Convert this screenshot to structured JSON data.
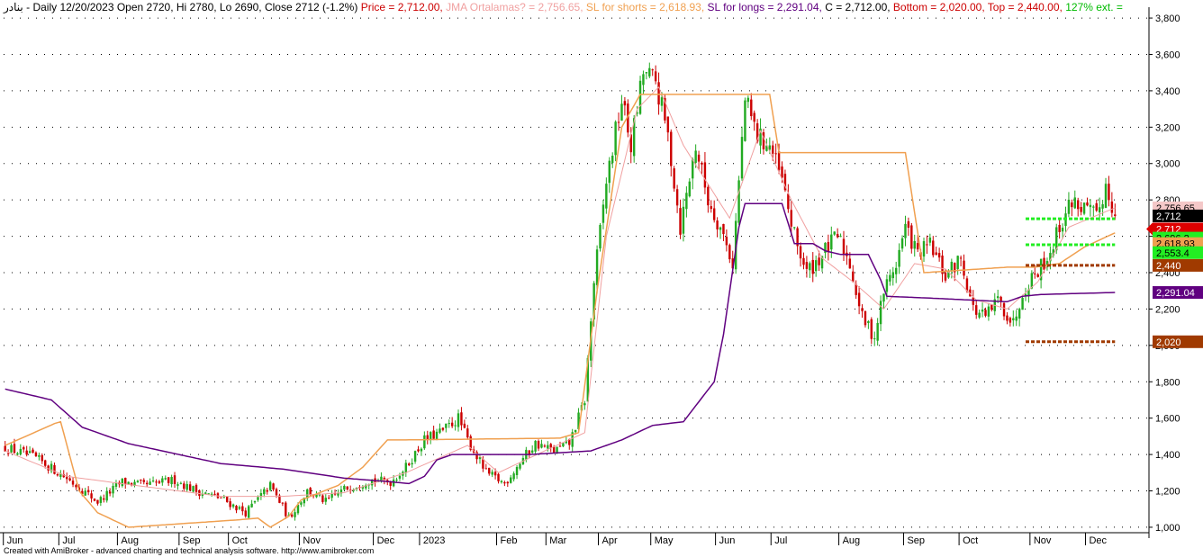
{
  "header": {
    "symbol": "بنادر",
    "info": "- Daily 12/20/2023 Open 2720, Hi 2780, Lo 2690, Close 2712 (-1.2%)",
    "price_label": "Price = 2,712.00,",
    "jma_label": "JMA Ortalamas? = 2,756.65,",
    "sls_label": "SL for shorts = 2,618.93,",
    "sll_label": "SL for longs = 2,291.04,",
    "c_label": "C = 2,712.00,",
    "bottom_label": "Bottom = 2,020.00,",
    "top_label": "Top = 2,440.00,",
    "ext_label": "127% ext. ="
  },
  "colors": {
    "up": "#22aa22",
    "down": "#cc0000",
    "price_label": "#cc0000",
    "jma": "#f0a0a0",
    "sl_shorts": "#f0a050",
    "sl_longs": "#600080",
    "bottom": "#cc0000",
    "top": "#cc0000",
    "ext": "#00bb00",
    "green_level": "#22ee22",
    "brown_level": "#a03a00"
  },
  "footer": "Created with AmiBroker - advanced charting and technical analysis software. http://www.amibroker.com",
  "chart_data": {
    "type": "candlestick",
    "ylim": [
      970,
      3830
    ],
    "yticks": [
      1000,
      1200,
      1400,
      1600,
      1800,
      2000,
      2200,
      2400,
      2600,
      2800,
      3000,
      3200,
      3400,
      3600,
      3800
    ],
    "ytick_labels": [
      "1,000",
      "1,200",
      "1,400",
      "1,600",
      "1,800",
      "2,000",
      "2,200",
      "2,400",
      "2,600",
      "2,800",
      "3,000",
      "3,200",
      "3,400",
      "3,600",
      "3,800"
    ],
    "xticks": [
      {
        "label": "Jun",
        "bar": 0
      },
      {
        "label": "Jul",
        "bar": 18
      },
      {
        "label": "Aug",
        "bar": 37
      },
      {
        "label": "Sep",
        "bar": 57
      },
      {
        "label": "Oct",
        "bar": 73
      },
      {
        "label": "Nov",
        "bar": 96
      },
      {
        "label": "Dec",
        "bar": 120
      },
      {
        "label": "2023",
        "bar": 135
      },
      {
        "label": "Feb",
        "bar": 160
      },
      {
        "label": "Mar",
        "bar": 176
      },
      {
        "label": "Apr",
        "bar": 193
      },
      {
        "label": "May",
        "bar": 210
      },
      {
        "label": "Jun",
        "bar": 231
      },
      {
        "label": "Jul",
        "bar": 249
      },
      {
        "label": "Aug",
        "bar": 271
      },
      {
        "label": "Sep",
        "bar": 292
      },
      {
        "label": "Oct",
        "bar": 310
      },
      {
        "label": "Nov",
        "bar": 333
      },
      {
        "label": "Dec",
        "bar": 351
      }
    ],
    "close_keyframes": [
      [
        0,
        1440
      ],
      [
        10,
        1380
      ],
      [
        20,
        1270
      ],
      [
        30,
        1140
      ],
      [
        38,
        1250
      ],
      [
        45,
        1230
      ],
      [
        55,
        1260
      ],
      [
        62,
        1200
      ],
      [
        70,
        1160
      ],
      [
        78,
        1080
      ],
      [
        86,
        1230
      ],
      [
        92,
        1050
      ],
      [
        98,
        1200
      ],
      [
        104,
        1140
      ],
      [
        110,
        1210
      ],
      [
        118,
        1260
      ],
      [
        125,
        1250
      ],
      [
        130,
        1330
      ],
      [
        136,
        1480
      ],
      [
        142,
        1530
      ],
      [
        147,
        1600
      ],
      [
        150,
        1480
      ],
      [
        156,
        1300
      ],
      [
        162,
        1240
      ],
      [
        168,
        1380
      ],
      [
        172,
        1460
      ],
      [
        178,
        1420
      ],
      [
        183,
        1460
      ],
      [
        188,
        1700
      ],
      [
        191,
        2350
      ],
      [
        195,
        2900
      ],
      [
        200,
        3350
      ],
      [
        203,
        3100
      ],
      [
        207,
        3500
      ],
      [
        211,
        3450
      ],
      [
        215,
        3150
      ],
      [
        219,
        2650
      ],
      [
        224,
        3100
      ],
      [
        228,
        2800
      ],
      [
        232,
        2650
      ],
      [
        236,
        2450
      ],
      [
        240,
        3350
      ],
      [
        244,
        3150
      ],
      [
        248,
        3100
      ],
      [
        252,
        2900
      ],
      [
        256,
        2600
      ],
      [
        260,
        2400
      ],
      [
        265,
        2500
      ],
      [
        270,
        2600
      ],
      [
        274,
        2450
      ],
      [
        278,
        2150
      ],
      [
        282,
        2050
      ],
      [
        285,
        2300
      ],
      [
        289,
        2450
      ],
      [
        292,
        2650
      ],
      [
        296,
        2500
      ],
      [
        300,
        2550
      ],
      [
        305,
        2380
      ],
      [
        310,
        2480
      ],
      [
        314,
        2200
      ],
      [
        318,
        2150
      ],
      [
        322,
        2250
      ],
      [
        327,
        2120
      ],
      [
        330,
        2300
      ],
      [
        334,
        2400
      ],
      [
        338,
        2480
      ],
      [
        342,
        2650
      ],
      [
        346,
        2800
      ],
      [
        350,
        2750
      ],
      [
        354,
        2700
      ],
      [
        357,
        2880
      ],
      [
        360,
        2712
      ]
    ],
    "last": {
      "open": 2720,
      "high": 2780,
      "low": 2690,
      "close": 2712
    },
    "jma_keyframes": [
      [
        0,
        1420
      ],
      [
        20,
        1280
      ],
      [
        40,
        1235
      ],
      [
        70,
        1170
      ],
      [
        90,
        1170
      ],
      [
        110,
        1190
      ],
      [
        130,
        1300
      ],
      [
        150,
        1450
      ],
      [
        160,
        1300
      ],
      [
        175,
        1420
      ],
      [
        188,
        1520
      ],
      [
        195,
        2600
      ],
      [
        205,
        3300
      ],
      [
        212,
        3420
      ],
      [
        220,
        3100
      ],
      [
        235,
        2700
      ],
      [
        245,
        3180
      ],
      [
        255,
        2800
      ],
      [
        265,
        2480
      ],
      [
        275,
        2350
      ],
      [
        285,
        2200
      ],
      [
        295,
        2450
      ],
      [
        305,
        2420
      ],
      [
        315,
        2250
      ],
      [
        325,
        2200
      ],
      [
        335,
        2350
      ],
      [
        345,
        2650
      ],
      [
        360,
        2756.65
      ]
    ],
    "sl_shorts_keyframes": [
      [
        0,
        1450
      ],
      [
        16,
        1570
      ],
      [
        18,
        1580
      ],
      [
        24,
        1200
      ],
      [
        30,
        1080
      ],
      [
        40,
        1000
      ],
      [
        75,
        1040
      ],
      [
        82,
        1050
      ],
      [
        86,
        1000
      ],
      [
        92,
        1060
      ],
      [
        96,
        1150
      ],
      [
        108,
        1230
      ],
      [
        116,
        1330
      ],
      [
        124,
        1480
      ],
      [
        128,
        1480
      ],
      [
        180,
        1490
      ],
      [
        186,
        1520
      ],
      [
        192,
        2300
      ],
      [
        200,
        3200
      ],
      [
        206,
        3380
      ],
      [
        248,
        3380
      ],
      [
        251,
        3060
      ],
      [
        292,
        3060
      ],
      [
        298,
        2400
      ],
      [
        325,
        2430
      ],
      [
        334,
        2430
      ],
      [
        342,
        2450
      ],
      [
        350,
        2540
      ],
      [
        360,
        2618.93
      ]
    ],
    "sl_longs_keyframes": [
      [
        0,
        1760
      ],
      [
        15,
        1700
      ],
      [
        25,
        1550
      ],
      [
        40,
        1460
      ],
      [
        70,
        1350
      ],
      [
        90,
        1320
      ],
      [
        110,
        1270
      ],
      [
        125,
        1250
      ],
      [
        131,
        1240
      ],
      [
        136,
        1280
      ],
      [
        140,
        1370
      ],
      [
        145,
        1400
      ],
      [
        170,
        1400
      ],
      [
        190,
        1420
      ],
      [
        200,
        1480
      ],
      [
        210,
        1560
      ],
      [
        220,
        1580
      ],
      [
        230,
        1800
      ],
      [
        233,
        2060
      ],
      [
        238,
        2650
      ],
      [
        240,
        2780
      ],
      [
        252,
        2780
      ],
      [
        256,
        2560
      ],
      [
        262,
        2560
      ],
      [
        266,
        2520
      ],
      [
        271,
        2500
      ],
      [
        280,
        2500
      ],
      [
        284,
        2360
      ],
      [
        286,
        2270
      ],
      [
        300,
        2260
      ],
      [
        325,
        2240
      ],
      [
        330,
        2270
      ],
      [
        336,
        2280
      ],
      [
        360,
        2291.04
      ]
    ],
    "levels": [
      {
        "name": "top",
        "value": 2440,
        "from_bar": 331,
        "to_bar": 360,
        "style": "brown"
      },
      {
        "name": "bottom",
        "value": 2020,
        "from_bar": 331,
        "to_bar": 360,
        "style": "brown"
      },
      {
        "name": "level_a",
        "value": 2696.2,
        "from_bar": 331,
        "to_bar": 360,
        "style": "green"
      },
      {
        "name": "level_b",
        "value": 2553.4,
        "from_bar": 331,
        "to_bar": 360,
        "style": "green"
      }
    ],
    "right_labels": [
      {
        "text": "2,756.65",
        "value": 2756.65,
        "bg": "#f4c8c8",
        "fg": "#000000"
      },
      {
        "text": "2,712",
        "value": 2712,
        "bg": "#000000",
        "fg": "#ffffff"
      },
      {
        "text": "2,712",
        "value": 2640,
        "bg": "#dd0000",
        "fg": "#ffffff",
        "arrow": true
      },
      {
        "text": "2,696.2",
        "value": 2590,
        "bg": "#22ee22",
        "fg": "#000000"
      },
      {
        "text": "2,618.93",
        "value": 2560,
        "bg": "#f0a050",
        "fg": "#000000"
      },
      {
        "text": "2,553.4",
        "value": 2510,
        "bg": "#22ee22",
        "fg": "#000000"
      },
      {
        "text": "2,440",
        "value": 2440,
        "bg": "#a03a00",
        "fg": "#ffffff"
      },
      {
        "text": "2,291.04",
        "value": 2291.04,
        "bg": "#600080",
        "fg": "#ffffff"
      },
      {
        "text": "2,020",
        "value": 2020,
        "bg": "#a03a00",
        "fg": "#ffffff"
      }
    ]
  }
}
